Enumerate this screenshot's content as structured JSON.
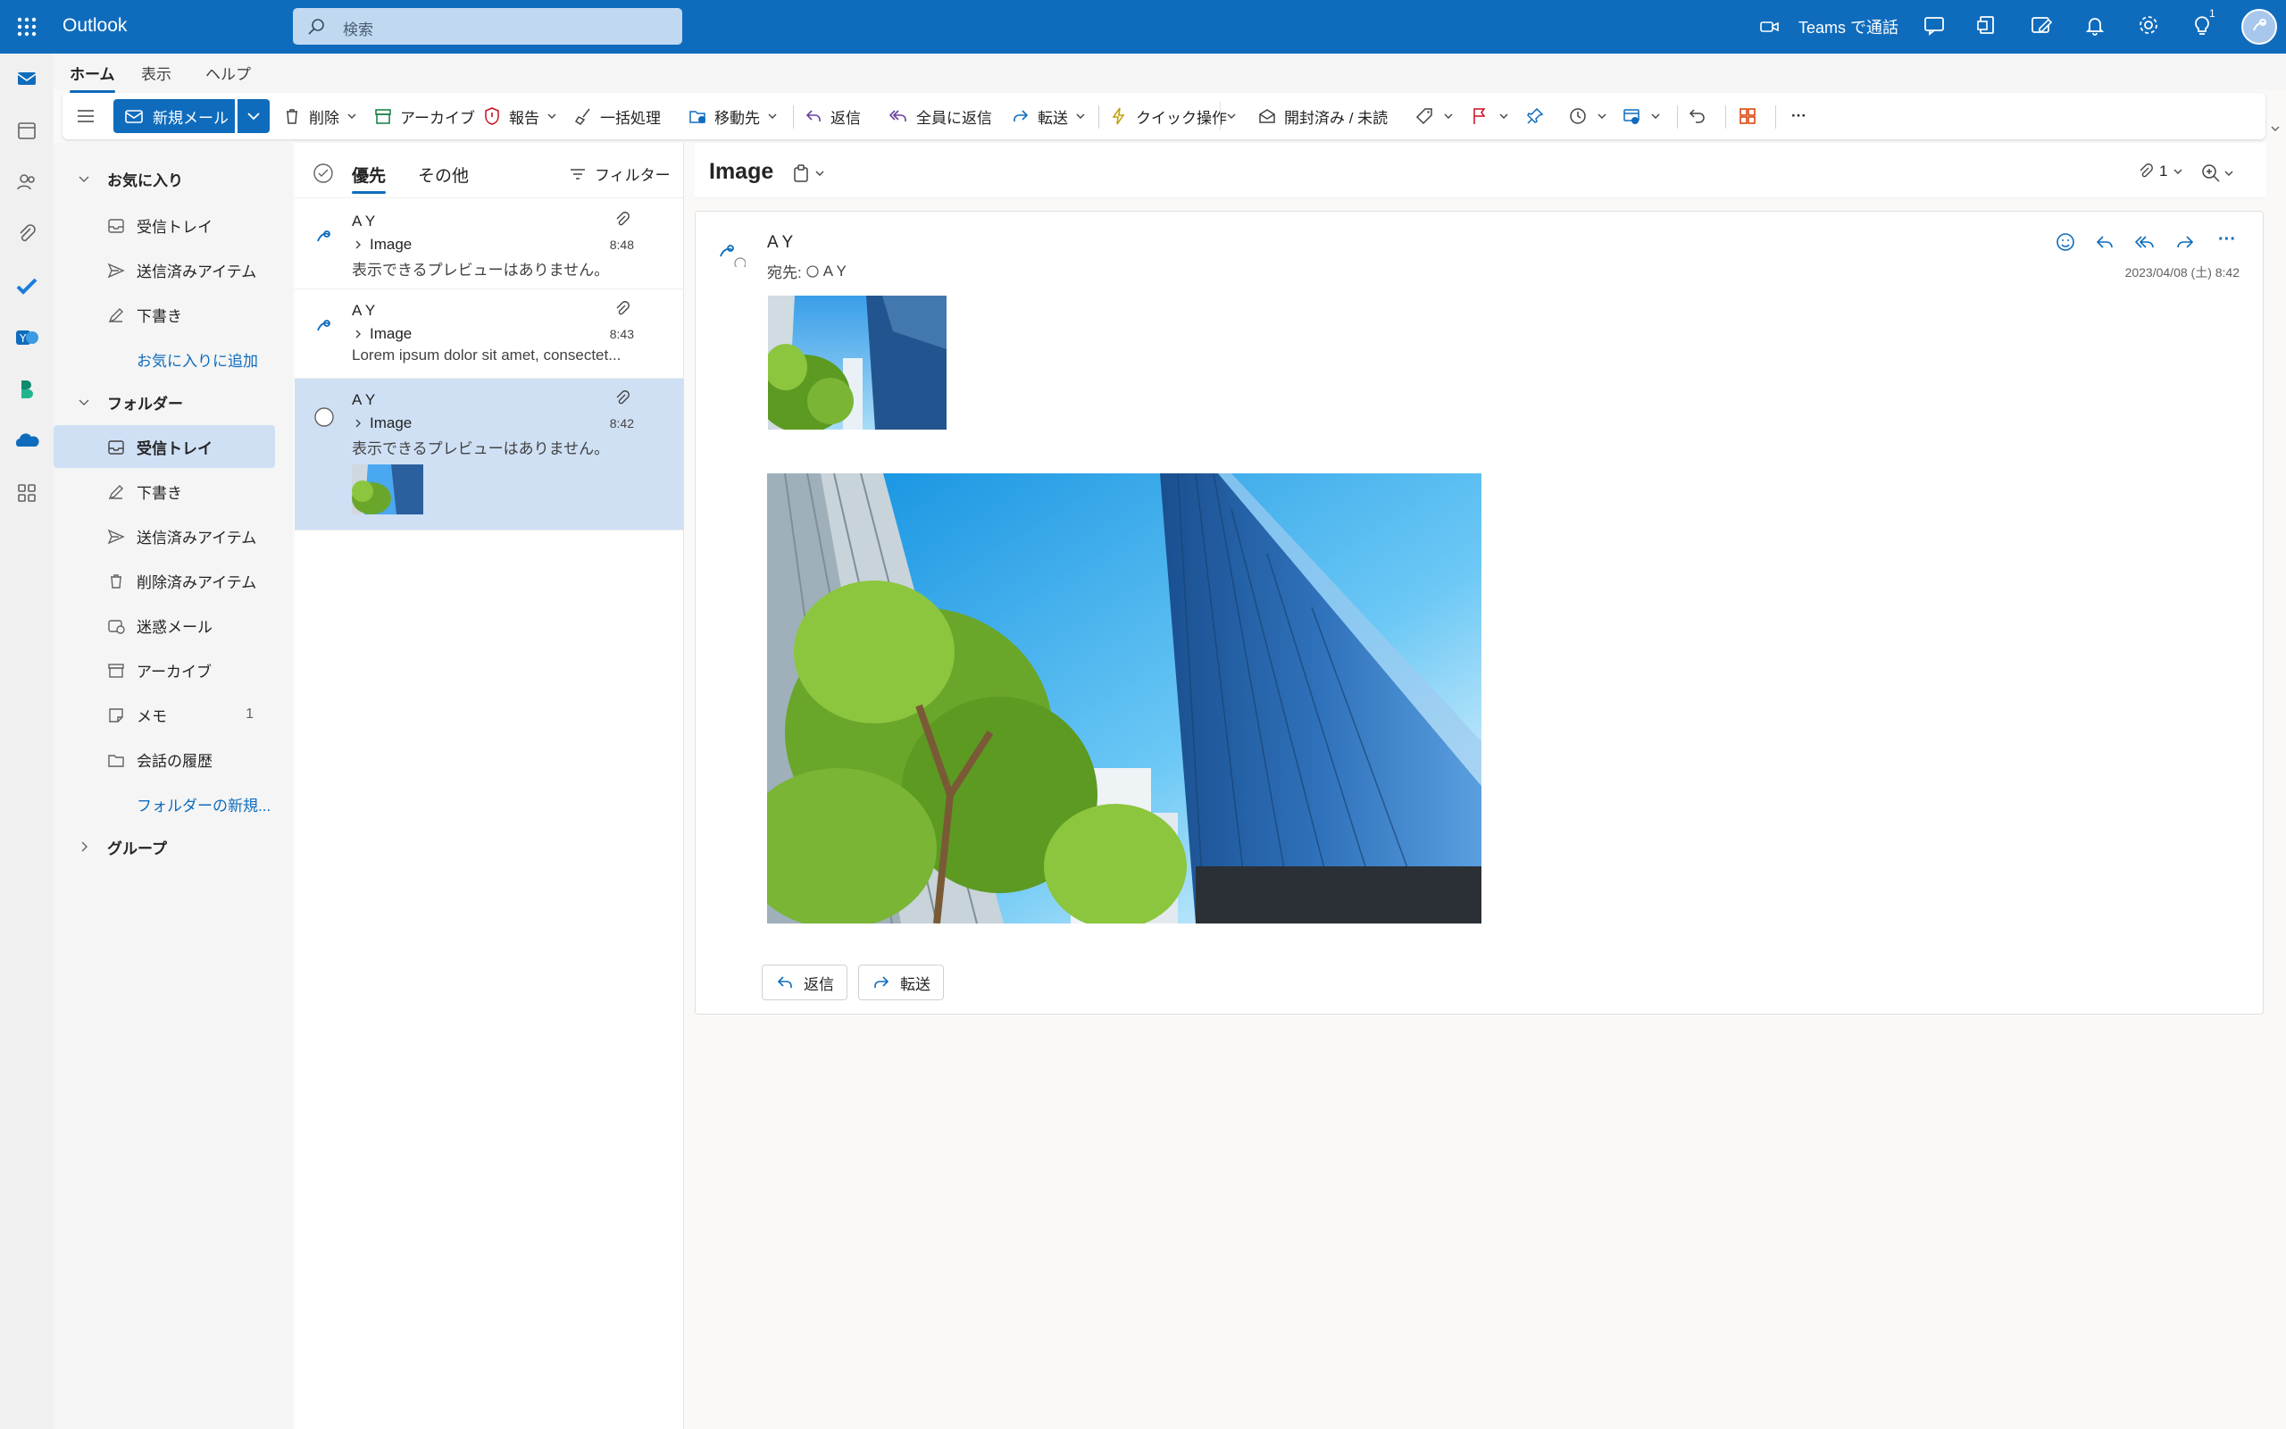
{
  "header": {
    "app_name": "Outlook",
    "search_placeholder": "検索",
    "teams_label": "Teams で通話",
    "notification_count": "1"
  },
  "tabs": [
    {
      "label": "ホーム"
    },
    {
      "label": "表示"
    },
    {
      "label": "ヘルプ"
    }
  ],
  "ribbon": {
    "new_mail": "新規メール",
    "delete": "削除",
    "archive": "アーカイブ",
    "report": "報告",
    "sweep": "一括処理",
    "move_to": "移動先",
    "reply": "返信",
    "reply_all": "全員に返信",
    "forward": "転送",
    "quick_steps": "クイック操作",
    "read_unread": "開封済み / 未読",
    "more": "···"
  },
  "nav": {
    "favorites_header": "お気に入り",
    "favorites": [
      {
        "label": "受信トレイ"
      },
      {
        "label": "送信済みアイテム"
      },
      {
        "label": "下書き"
      }
    ],
    "add_favorite": "お気に入りに追加",
    "folders_header": "フォルダー",
    "folders": [
      {
        "label": "受信トレイ"
      },
      {
        "label": "下書き"
      },
      {
        "label": "送信済みアイテム"
      },
      {
        "label": "削除済みアイテム"
      },
      {
        "label": "迷惑メール"
      },
      {
        "label": "アーカイブ"
      },
      {
        "label": "メモ",
        "count": "1"
      },
      {
        "label": "会話の履歴"
      }
    ],
    "new_folder": "フォルダーの新規...",
    "groups_header": "グループ"
  },
  "list": {
    "tab_focused": "優先",
    "tab_other": "その他",
    "filter": "フィルター",
    "messages": [
      {
        "sender": "A Y",
        "subject": "Image",
        "preview": "表示できるプレビューはありません。",
        "time": "8:48"
      },
      {
        "sender": "A Y",
        "subject": "Image",
        "preview": "Lorem ipsum dolor sit amet, consectet...",
        "time": "8:43"
      },
      {
        "sender": "A Y",
        "subject": "Image",
        "preview": "表示できるプレビューはありません。",
        "time": "8:42"
      }
    ]
  },
  "reading": {
    "subject": "Image",
    "attachment_count": "1",
    "sender": "A Y",
    "to_label": "宛先:",
    "to_name": "A Y",
    "date": "2023/04/08 (土) 8:42",
    "reply": "返信",
    "forward": "転送"
  },
  "colors": {
    "brand": "#0f6cbd",
    "selected": "#cfe0f5"
  }
}
